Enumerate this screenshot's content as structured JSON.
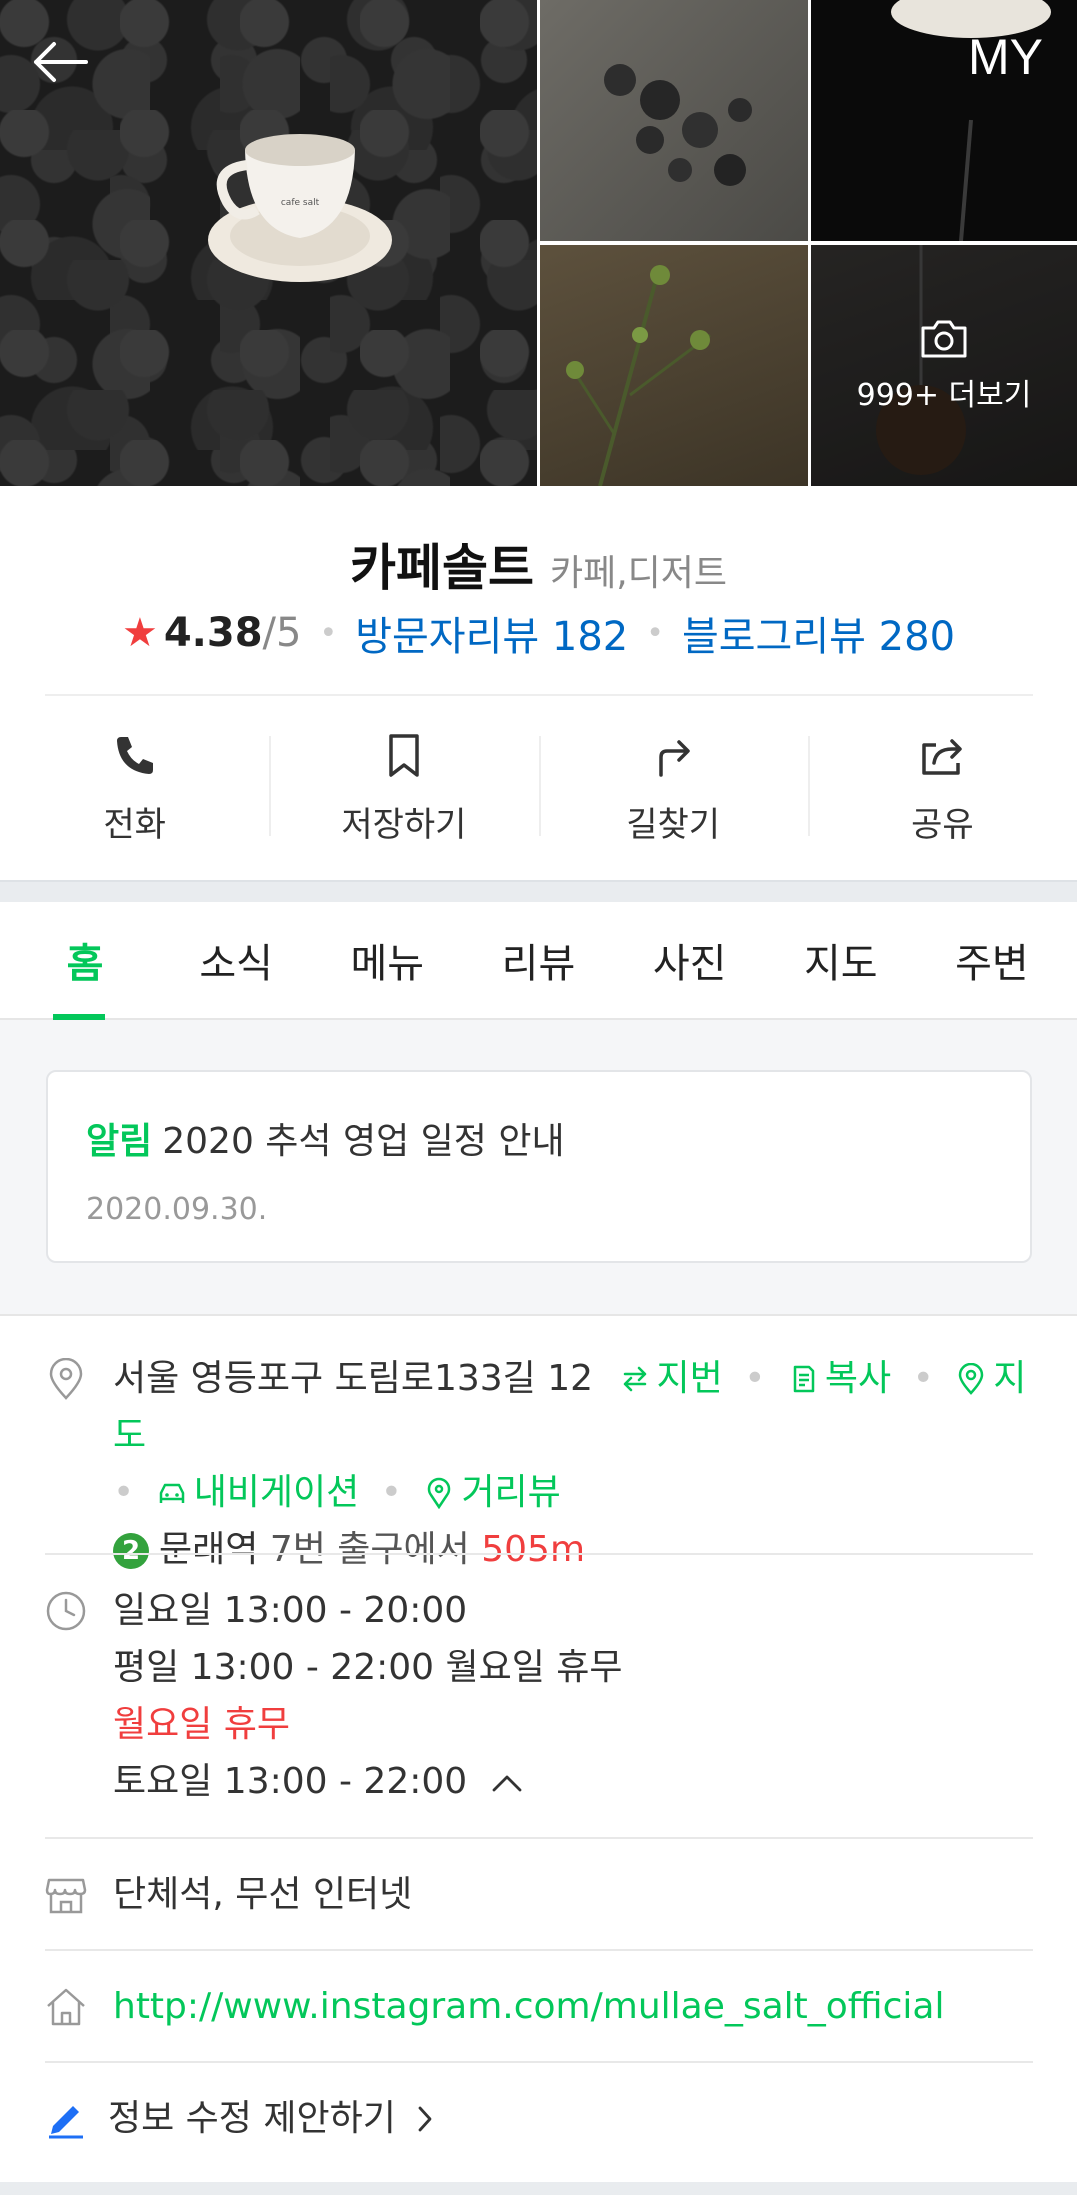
{
  "header": {
    "my_label": "MY"
  },
  "gallery": {
    "more_label": "999+ 더보기",
    "cup_text": "cafe salt"
  },
  "place": {
    "name": "카페솔트",
    "category": "카페,디저트",
    "rating": "4.38",
    "rating_max": "/5",
    "visitor_reviews": "방문자리뷰 182",
    "blog_reviews": "블로그리뷰 280"
  },
  "actions": [
    {
      "label": "전화",
      "icon": "phone-icon"
    },
    {
      "label": "저장하기",
      "icon": "bookmark-icon"
    },
    {
      "label": "길찾기",
      "icon": "directions-icon"
    },
    {
      "label": "공유",
      "icon": "share-icon"
    }
  ],
  "tabs": [
    "홈",
    "소식",
    "메뉴",
    "리뷰",
    "사진",
    "지도",
    "주변"
  ],
  "active_tab": "홈",
  "notice": {
    "label": "알림",
    "title": "2020 추석 영업 일정 안내",
    "date": "2020.09.30."
  },
  "address": {
    "text": "서울 영등포구 도림로133길 12",
    "jibun": "지번",
    "copy": "복사",
    "map": "지도",
    "navigation": "내비게이션",
    "street_view": "거리뷰",
    "subway_line": "2",
    "station": "문래역",
    "exit": "7번 출구에서",
    "distance": "505m"
  },
  "hours": {
    "line1": "일요일 13:00 - 20:00",
    "line2": "평일 13:00 - 22:00 월요일 휴무",
    "line3": "월요일 휴무",
    "line4": "토요일 13:00 - 22:00"
  },
  "facilities": "단체석, 무선 인터넷",
  "website": "http://www.instagram.com/mullae_salt_official",
  "suggest_edit": "정보 수정 제안하기",
  "colors": {
    "accent": "#03c75a",
    "link": "#0068c3",
    "alert": "#f03e3e"
  }
}
